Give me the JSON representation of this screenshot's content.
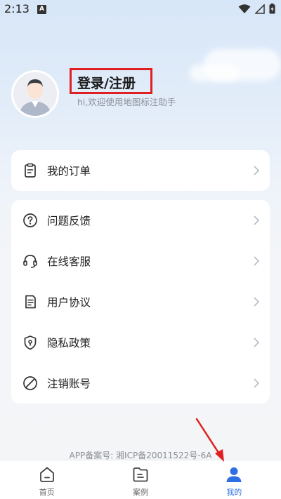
{
  "status_bar": {
    "time": "2:13",
    "notification_badge": "A"
  },
  "profile": {
    "title": "登录/注册",
    "subtitle": "hi,欢迎使用地图标注助手"
  },
  "orders_card": {
    "items": [
      {
        "label": "我的订单",
        "icon": "clipboard-icon"
      }
    ]
  },
  "menu_card": {
    "items": [
      {
        "label": "问题反馈",
        "icon": "question-circle-icon"
      },
      {
        "label": "在线客服",
        "icon": "headset-icon"
      },
      {
        "label": "用户协议",
        "icon": "document-icon"
      },
      {
        "label": "隐私政策",
        "icon": "shield-icon"
      },
      {
        "label": "注销账号",
        "icon": "ban-icon"
      }
    ]
  },
  "footer": {
    "icp": "APP备案号: 湘ICP备20011522号-6A"
  },
  "bottom_nav": {
    "items": [
      {
        "label": "首页",
        "icon": "home-icon",
        "active": false
      },
      {
        "label": "案例",
        "icon": "folder-icon",
        "active": false
      },
      {
        "label": "我的",
        "icon": "user-icon",
        "active": true
      }
    ]
  },
  "colors": {
    "accent": "#2f6fe4",
    "highlight": "#e02020"
  }
}
